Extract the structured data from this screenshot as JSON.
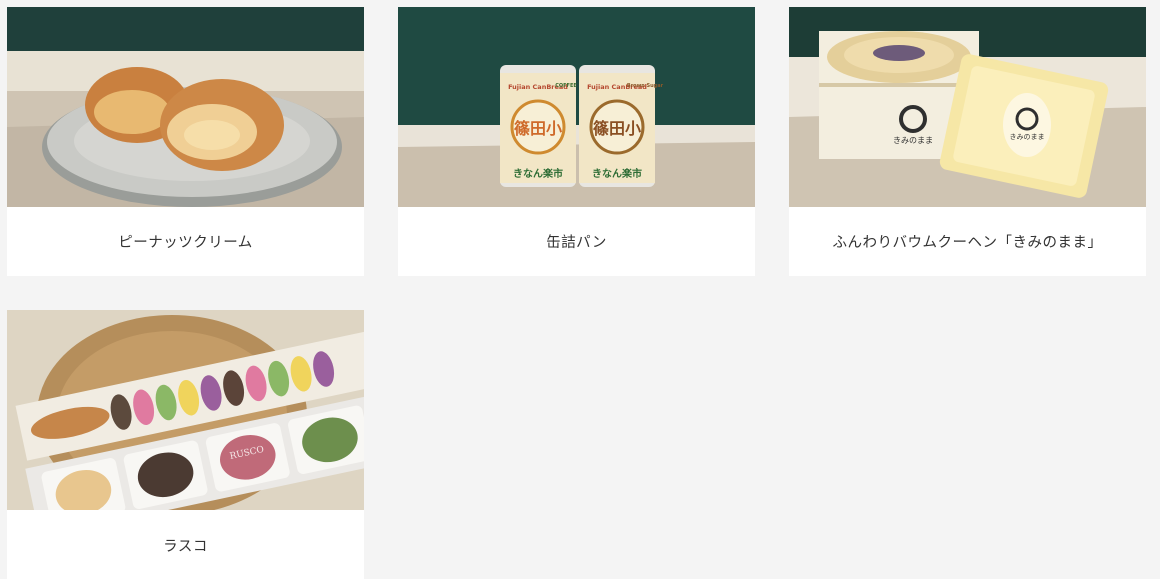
{
  "products": [
    {
      "name": "ピーナッツクリーム",
      "image": "peanut-cream-pastry-photo"
    },
    {
      "name": "缶詰パン",
      "image": "canned-bread-photo",
      "can_left": {
        "brand": "Fujian CanBread",
        "flavor": "COFFEE",
        "kanji": "篠田小",
        "logo": "きなん楽市"
      },
      "can_right": {
        "brand": "Fujian CanBread",
        "flavor": "Brown Sugar",
        "kanji": "篠田小",
        "logo": "きなん楽市"
      }
    },
    {
      "name": "ふんわりバウムクーヘン「きみのまま」",
      "image": "baumkuchen-photo",
      "box_text": "きみのまま",
      "pack_text": "きみのまま"
    },
    {
      "name": "ラスコ",
      "image": "rusco-photo",
      "pack_text": "RUSCO"
    }
  ]
}
